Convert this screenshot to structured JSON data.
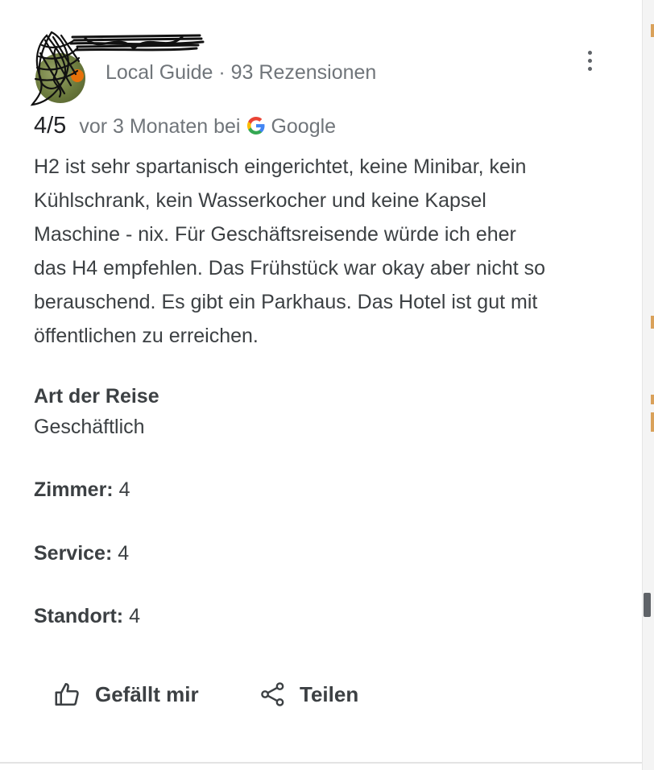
{
  "review": {
    "reviewer_meta": "Local Guide · 93 Rezensionen",
    "rating": "4/5",
    "time": "vor 3 Monaten bei",
    "source": "Google",
    "text_lines": [
      "H2 ist sehr spartanisch eingerichtet, keine Minibar, kein",
      "Kühlschrank, kein Wasserkocher und keine Kapsel",
      "Maschine - nix. Für Geschäftsreisende würde ich eher",
      "das H4 empfehlen. Das Frühstück war okay aber nicht so",
      "berauschend. Es gibt ein Parkhaus. Das Hotel ist gut mit",
      "öffentlichen zu erreichen."
    ],
    "trip": {
      "label": "Art der Reise",
      "value": "Geschäftlich"
    },
    "sub_ratings": [
      {
        "label": "Zimmer:",
        "value": "4"
      },
      {
        "label": "Service:",
        "value": "4"
      },
      {
        "label": "Standort:",
        "value": "4"
      }
    ]
  },
  "actions": {
    "like_label": "Gefällt mir",
    "share_label": "Teilen"
  },
  "icons": {
    "more": "more-vert-icon",
    "google": "google-g-icon",
    "like": "thumb-up-icon",
    "share": "share-icon"
  },
  "colors": {
    "text_primary": "#202124",
    "text_body": "#3c4043",
    "text_secondary": "#70757a",
    "icon": "#5f6368",
    "local_guide_badge": "#e8710a"
  }
}
